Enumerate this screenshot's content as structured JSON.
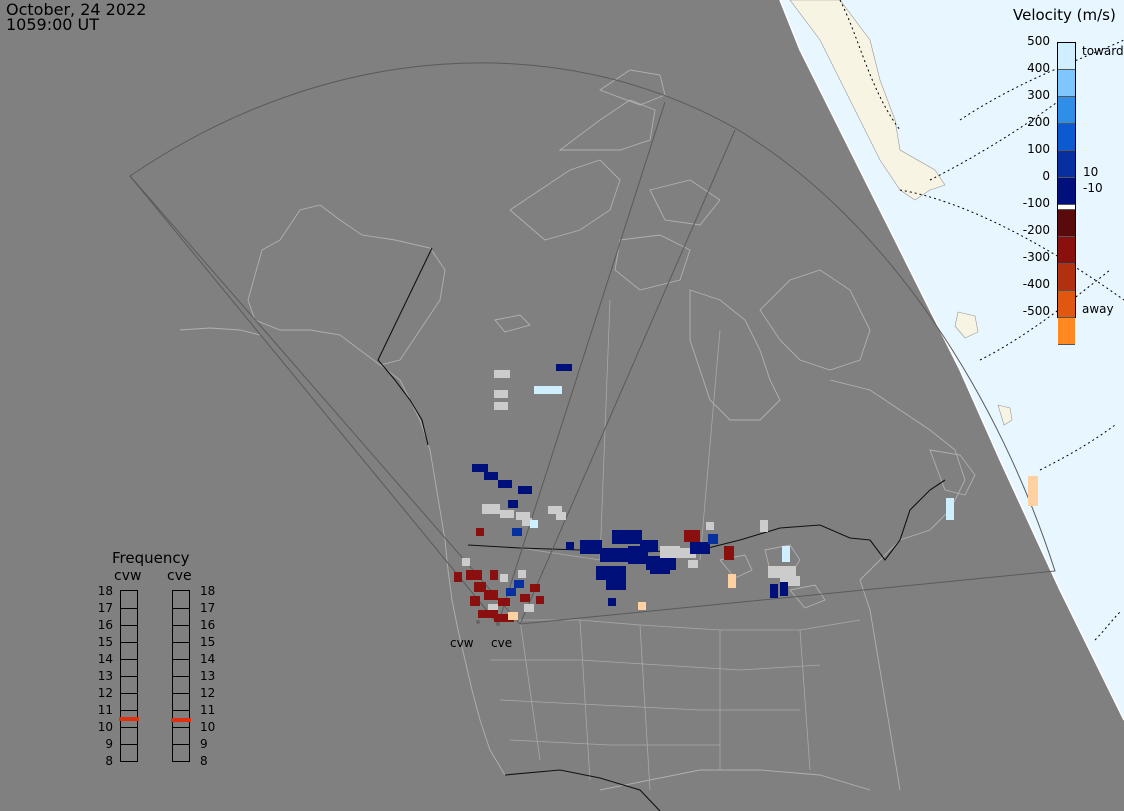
{
  "header": {
    "date": "October, 24 2022",
    "time": "1059:00 UT"
  },
  "velocity_legend": {
    "title": "Velocity (m/s)",
    "ticks_left": [
      "500",
      "400",
      "300",
      "200",
      "100",
      "0",
      "-100",
      "-200",
      "-300",
      "-400",
      "-500"
    ],
    "label_toward": "toward",
    "label_away": "away",
    "threshold_pos": "10",
    "threshold_neg": "-10",
    "colors": [
      "#cfeeff",
      "#7fc6ff",
      "#2f8ee8",
      "#0b5ad0",
      "#0630a0",
      "#00107a",
      "#ffffff",
      "#5a0a0a",
      "#8a1010",
      "#b03010",
      "#e05810",
      "#ff8820",
      "#ffd0a0"
    ]
  },
  "frequency_legend": {
    "title": "Frequency",
    "radar_left": "cvw",
    "radar_right": "cve",
    "ticks": [
      "18",
      "17",
      "16",
      "15",
      "14",
      "13",
      "12",
      "11",
      "10",
      "9",
      "8"
    ],
    "cvw_mhz": 10.5,
    "cve_mhz": 10.4,
    "marker_color": "#e03010"
  },
  "radars": [
    {
      "name": "cvw"
    },
    {
      "name": "cve"
    }
  ],
  "colors": {
    "background": "#808080",
    "ocean": "#e8f6ff",
    "land_far": "#f7f4e4",
    "coast": "#b0b0b0",
    "fov": "#555555",
    "ground_scatter": "#cccccc"
  }
}
